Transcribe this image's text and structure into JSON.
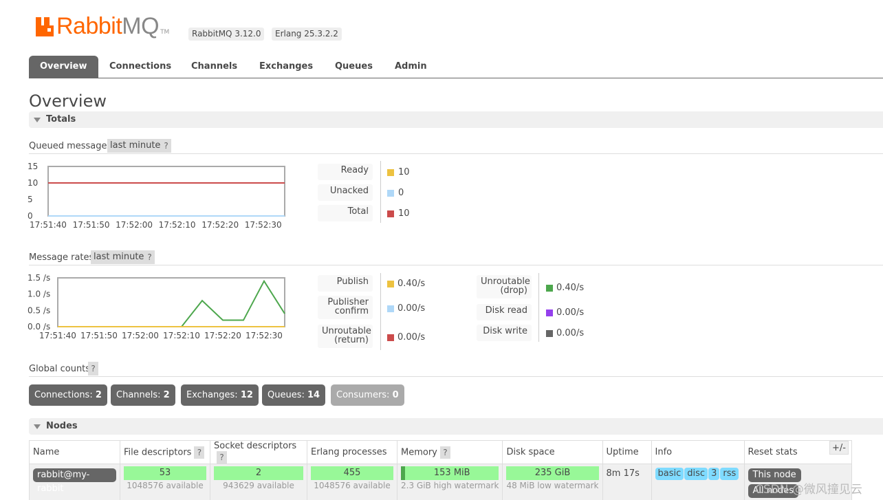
{
  "header": {
    "logo_rabbit": "Rabbit",
    "logo_mq": "MQ",
    "logo_tm": "TM",
    "version_badges": [
      "RabbitMQ 3.12.0",
      "Erlang 25.3.2.2"
    ]
  },
  "tabs": [
    {
      "label": "Overview",
      "active": true
    },
    {
      "label": "Connections"
    },
    {
      "label": "Channels"
    },
    {
      "label": "Exchanges"
    },
    {
      "label": "Queues"
    },
    {
      "label": "Admin"
    }
  ],
  "page_title": "Overview",
  "totals": {
    "section_label": "Totals",
    "queued": {
      "label": "Queued messages",
      "range": "last minute",
      "help": "?",
      "legend": [
        {
          "name": "Ready",
          "value": "10",
          "color": "#edc240"
        },
        {
          "name": "Unacked",
          "value": "0",
          "color": "#afd8f8"
        },
        {
          "name": "Total",
          "value": "10",
          "color": "#cb4b4b"
        }
      ]
    },
    "rates": {
      "label": "Message rates",
      "range": "last minute",
      "help": "?",
      "legend_left": [
        {
          "name1": "Publish",
          "name2": "",
          "value": "0.40/s",
          "color": "#edc240"
        },
        {
          "name1": "Publisher",
          "name2": "confirm",
          "value": "0.00/s",
          "color": "#afd8f8"
        },
        {
          "name1": "Unroutable",
          "name2": "(return)",
          "value": "0.00/s",
          "color": "#cb4b4b"
        }
      ],
      "legend_right": [
        {
          "name1": "Unroutable",
          "name2": "(drop)",
          "value": "0.40/s",
          "color": "#4da74d"
        },
        {
          "name1": "Disk read",
          "name2": "",
          "value": "0.00/s",
          "color": "#9440ed"
        },
        {
          "name1": "Disk write",
          "name2": "",
          "value": "0.00/s",
          "color": "#666666"
        }
      ]
    }
  },
  "chart_data": [
    {
      "type": "line",
      "title": "",
      "x": [
        "17:51:40",
        "17:51:50",
        "17:52:00",
        "17:52:10",
        "17:52:20",
        "17:52:30"
      ],
      "ylim": [
        0,
        15
      ],
      "yticks": [
        "15",
        "10",
        "5",
        "0"
      ],
      "series": [
        {
          "name": "Ready",
          "color": "#edc240",
          "values": [
            10,
            10,
            10,
            10,
            10,
            10
          ]
        },
        {
          "name": "Unacked",
          "color": "#afd8f8",
          "values": [
            0,
            0,
            0,
            0,
            0,
            0
          ]
        },
        {
          "name": "Total",
          "color": "#cb4b4b",
          "values": [
            10,
            10,
            10,
            10,
            10,
            10
          ]
        }
      ]
    },
    {
      "type": "line",
      "title": "",
      "x": [
        "17:51:40",
        "17:51:50",
        "17:52:00",
        "17:52:10",
        "17:52:20",
        "17:52:30"
      ],
      "ylim": [
        0,
        1.5
      ],
      "yticks": [
        "1.5 /s",
        "1.0 /s",
        "0.5 /s",
        "0.0 /s"
      ],
      "series": [
        {
          "name": "Unroutable (drop)",
          "color": "#4da74d",
          "points": [
            [
              0,
              0
            ],
            [
              30,
              0
            ],
            [
              35,
              0.8
            ],
            [
              40,
              0.2
            ],
            [
              45,
              0.2
            ],
            [
              50,
              1.4
            ],
            [
              55,
              0.4
            ]
          ]
        },
        {
          "name": "Publish",
          "color": "#edc240",
          "points": [
            [
              0,
              0
            ],
            [
              55,
              0
            ]
          ]
        }
      ]
    }
  ],
  "global_counts": {
    "label": "Global counts",
    "help": "?",
    "items": [
      {
        "label": "Connections:",
        "value": "2"
      },
      {
        "label": "Channels:",
        "value": "2"
      },
      {
        "label": "Exchanges:",
        "value": "12"
      },
      {
        "label": "Queues:",
        "value": "14"
      },
      {
        "label": "Consumers:",
        "value": "0"
      }
    ]
  },
  "nodes": {
    "section_label": "Nodes",
    "columns": [
      "Name",
      "File descriptors",
      "Socket descriptors",
      "Erlang processes",
      "Memory",
      "Disk space",
      "Uptime",
      "Info",
      "Reset stats"
    ],
    "help": "?",
    "plusminus": "+/-",
    "row": {
      "name": "rabbit@my-rabbit",
      "file_descriptors": {
        "used": "53",
        "available": "1048576 available",
        "fraction": 1.0
      },
      "socket_descriptors": {
        "used": "2",
        "available": "943629 available",
        "fraction": 1.0
      },
      "erlang_processes": {
        "used": "455",
        "available": "1048576 available",
        "fraction": 1.0
      },
      "memory": {
        "used": "153 MiB",
        "available": "2.3 GiB high watermark",
        "fraction": 1.0
      },
      "disk_space": {
        "used": "235 GiB",
        "available": "48 MiB low watermark",
        "fraction": 1.0
      },
      "uptime": "8m 17s",
      "info": [
        "basic",
        "disc",
        "3",
        "rss"
      ],
      "reset": [
        "This node",
        "All nodes"
      ]
    }
  },
  "watermark": "CSDN @微风撞见云"
}
